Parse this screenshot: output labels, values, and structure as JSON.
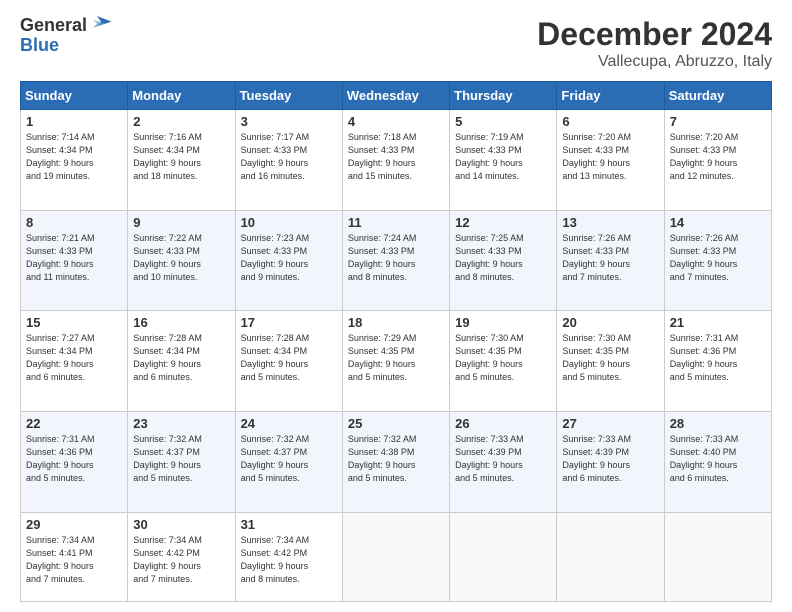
{
  "logo": {
    "general": "General",
    "blue": "Blue"
  },
  "title": {
    "month": "December 2024",
    "location": "Vallecupa, Abruzzo, Italy"
  },
  "weekdays": [
    "Sunday",
    "Monday",
    "Tuesday",
    "Wednesday",
    "Thursday",
    "Friday",
    "Saturday"
  ],
  "weeks": [
    [
      {
        "day": "1",
        "info": "Sunrise: 7:14 AM\nSunset: 4:34 PM\nDaylight: 9 hours\nand 19 minutes."
      },
      {
        "day": "2",
        "info": "Sunrise: 7:16 AM\nSunset: 4:34 PM\nDaylight: 9 hours\nand 18 minutes."
      },
      {
        "day": "3",
        "info": "Sunrise: 7:17 AM\nSunset: 4:33 PM\nDaylight: 9 hours\nand 16 minutes."
      },
      {
        "day": "4",
        "info": "Sunrise: 7:18 AM\nSunset: 4:33 PM\nDaylight: 9 hours\nand 15 minutes."
      },
      {
        "day": "5",
        "info": "Sunrise: 7:19 AM\nSunset: 4:33 PM\nDaylight: 9 hours\nand 14 minutes."
      },
      {
        "day": "6",
        "info": "Sunrise: 7:20 AM\nSunset: 4:33 PM\nDaylight: 9 hours\nand 13 minutes."
      },
      {
        "day": "7",
        "info": "Sunrise: 7:20 AM\nSunset: 4:33 PM\nDaylight: 9 hours\nand 12 minutes."
      }
    ],
    [
      {
        "day": "8",
        "info": "Sunrise: 7:21 AM\nSunset: 4:33 PM\nDaylight: 9 hours\nand 11 minutes."
      },
      {
        "day": "9",
        "info": "Sunrise: 7:22 AM\nSunset: 4:33 PM\nDaylight: 9 hours\nand 10 minutes."
      },
      {
        "day": "10",
        "info": "Sunrise: 7:23 AM\nSunset: 4:33 PM\nDaylight: 9 hours\nand 9 minutes."
      },
      {
        "day": "11",
        "info": "Sunrise: 7:24 AM\nSunset: 4:33 PM\nDaylight: 9 hours\nand 8 minutes."
      },
      {
        "day": "12",
        "info": "Sunrise: 7:25 AM\nSunset: 4:33 PM\nDaylight: 9 hours\nand 8 minutes."
      },
      {
        "day": "13",
        "info": "Sunrise: 7:26 AM\nSunset: 4:33 PM\nDaylight: 9 hours\nand 7 minutes."
      },
      {
        "day": "14",
        "info": "Sunrise: 7:26 AM\nSunset: 4:33 PM\nDaylight: 9 hours\nand 7 minutes."
      }
    ],
    [
      {
        "day": "15",
        "info": "Sunrise: 7:27 AM\nSunset: 4:34 PM\nDaylight: 9 hours\nand 6 minutes."
      },
      {
        "day": "16",
        "info": "Sunrise: 7:28 AM\nSunset: 4:34 PM\nDaylight: 9 hours\nand 6 minutes."
      },
      {
        "day": "17",
        "info": "Sunrise: 7:28 AM\nSunset: 4:34 PM\nDaylight: 9 hours\nand 5 minutes."
      },
      {
        "day": "18",
        "info": "Sunrise: 7:29 AM\nSunset: 4:35 PM\nDaylight: 9 hours\nand 5 minutes."
      },
      {
        "day": "19",
        "info": "Sunrise: 7:30 AM\nSunset: 4:35 PM\nDaylight: 9 hours\nand 5 minutes."
      },
      {
        "day": "20",
        "info": "Sunrise: 7:30 AM\nSunset: 4:35 PM\nDaylight: 9 hours\nand 5 minutes."
      },
      {
        "day": "21",
        "info": "Sunrise: 7:31 AM\nSunset: 4:36 PM\nDaylight: 9 hours\nand 5 minutes."
      }
    ],
    [
      {
        "day": "22",
        "info": "Sunrise: 7:31 AM\nSunset: 4:36 PM\nDaylight: 9 hours\nand 5 minutes."
      },
      {
        "day": "23",
        "info": "Sunrise: 7:32 AM\nSunset: 4:37 PM\nDaylight: 9 hours\nand 5 minutes."
      },
      {
        "day": "24",
        "info": "Sunrise: 7:32 AM\nSunset: 4:37 PM\nDaylight: 9 hours\nand 5 minutes."
      },
      {
        "day": "25",
        "info": "Sunrise: 7:32 AM\nSunset: 4:38 PM\nDaylight: 9 hours\nand 5 minutes."
      },
      {
        "day": "26",
        "info": "Sunrise: 7:33 AM\nSunset: 4:39 PM\nDaylight: 9 hours\nand 5 minutes."
      },
      {
        "day": "27",
        "info": "Sunrise: 7:33 AM\nSunset: 4:39 PM\nDaylight: 9 hours\nand 6 minutes."
      },
      {
        "day": "28",
        "info": "Sunrise: 7:33 AM\nSunset: 4:40 PM\nDaylight: 9 hours\nand 6 minutes."
      }
    ],
    [
      {
        "day": "29",
        "info": "Sunrise: 7:34 AM\nSunset: 4:41 PM\nDaylight: 9 hours\nand 7 minutes."
      },
      {
        "day": "30",
        "info": "Sunrise: 7:34 AM\nSunset: 4:42 PM\nDaylight: 9 hours\nand 7 minutes."
      },
      {
        "day": "31",
        "info": "Sunrise: 7:34 AM\nSunset: 4:42 PM\nDaylight: 9 hours\nand 8 minutes."
      },
      null,
      null,
      null,
      null
    ]
  ]
}
